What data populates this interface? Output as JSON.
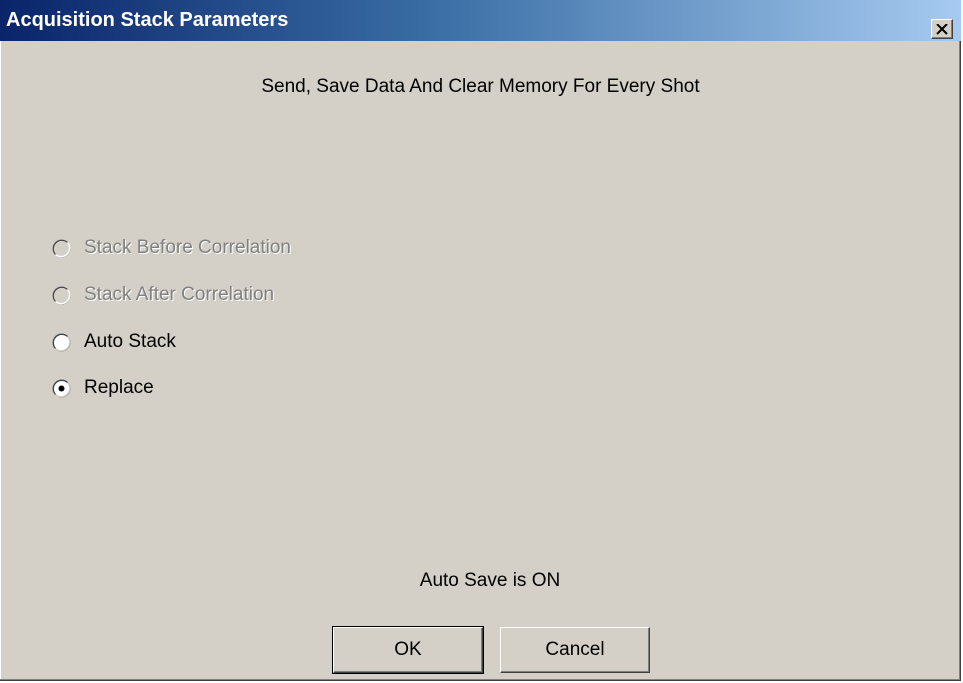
{
  "window": {
    "title": "Acquisition Stack Parameters",
    "close_icon": "close-icon"
  },
  "header": {
    "text": "Send, Save Data And Clear Memory For Every Shot"
  },
  "stack_options": [
    {
      "label": "Stack Before Correlation",
      "enabled": false,
      "selected": false
    },
    {
      "label": "Stack After Correlation",
      "enabled": false,
      "selected": false
    },
    {
      "label": "Auto Stack",
      "enabled": true,
      "selected": false
    },
    {
      "label": "Replace",
      "enabled": true,
      "selected": true
    }
  ],
  "status": {
    "text": "Auto Save is ON"
  },
  "buttons": {
    "ok_label": "OK",
    "cancel_label": "Cancel"
  },
  "colors": {
    "face": "#d4d0c8",
    "title_start": "#0a246a",
    "title_end": "#a6caf0",
    "disabled_text": "#808080"
  }
}
